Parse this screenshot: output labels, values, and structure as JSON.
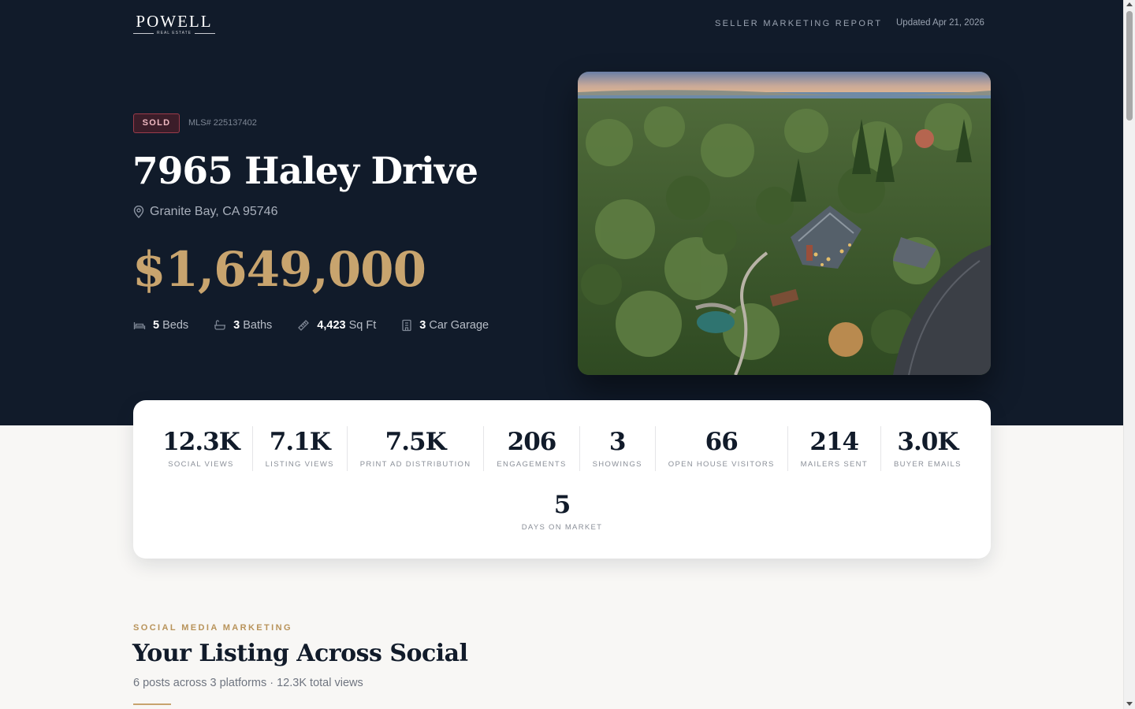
{
  "header": {
    "logo_main": "POWELL",
    "logo_sub": "REAL ESTATE",
    "report_title": "SELLER MARKETING REPORT",
    "updated": "Updated Apr 21, 2026"
  },
  "listing": {
    "status": "SOLD",
    "mls": "MLS# 225137402",
    "address": "7965 Haley Drive",
    "city": "Granite Bay, CA 95746",
    "price": "$1,649,000",
    "features": [
      {
        "icon": "bed-icon",
        "value": "5",
        "label": "Beds"
      },
      {
        "icon": "bath-icon",
        "value": "3",
        "label": "Baths"
      },
      {
        "icon": "ruler-icon",
        "value": "4,423",
        "label": "Sq Ft"
      },
      {
        "icon": "garage-icon",
        "value": "3",
        "label": "Car Garage"
      }
    ]
  },
  "stats": [
    {
      "value": "12.3K",
      "label": "Social Views"
    },
    {
      "value": "7.1K",
      "label": "Listing Views"
    },
    {
      "value": "7.5K",
      "label": "Print Ad Distribution"
    },
    {
      "value": "206",
      "label": "Engagements"
    },
    {
      "value": "3",
      "label": "Showings"
    },
    {
      "value": "66",
      "label": "Open House Visitors"
    },
    {
      "value": "214",
      "label": "Mailers Sent"
    },
    {
      "value": "3.0K",
      "label": "Buyer Emails"
    },
    {
      "value": "5",
      "label": "Days on Market"
    }
  ],
  "social": {
    "eyebrow": "SOCIAL MEDIA MARKETING",
    "title": "Your Listing Across Social",
    "subtitle": "6 posts across 3 platforms · 12.3K total views"
  },
  "colors": {
    "navy": "#111b2a",
    "gold": "#c8a46e",
    "sold_red": "#9b3b4a"
  }
}
